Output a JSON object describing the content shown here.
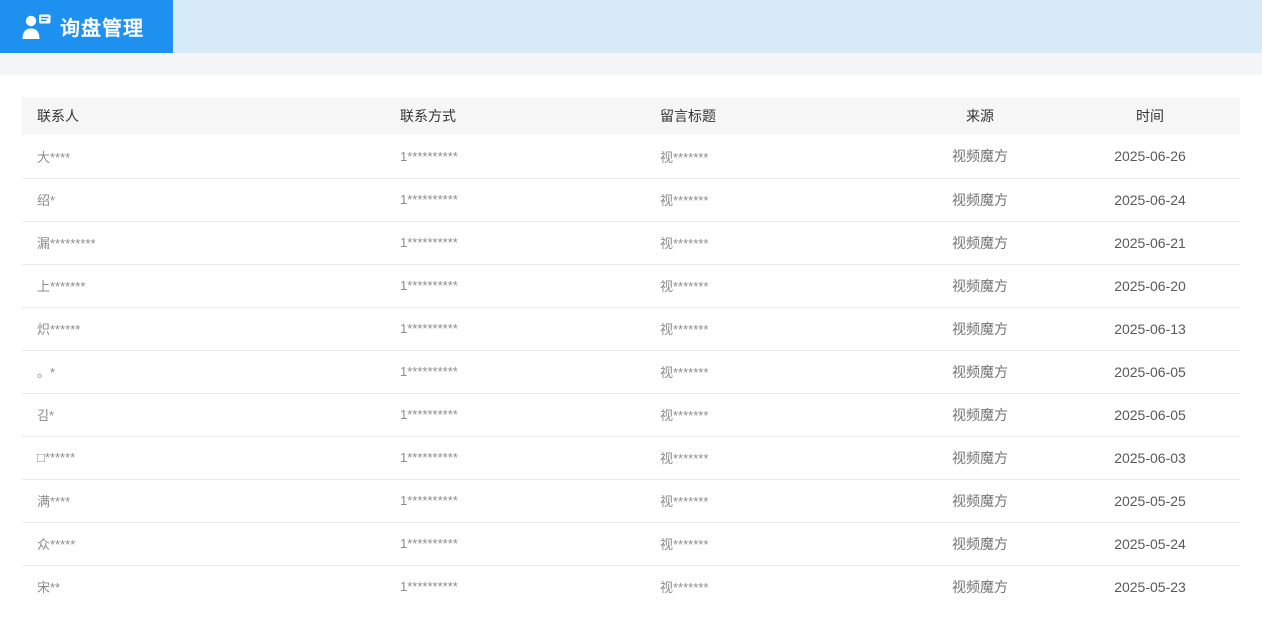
{
  "colors": {
    "tab_blue": "#1e90f0",
    "band_blue": "#d7eaf8",
    "strip_gray": "#f4f5f6",
    "thead_bg": "#f6f6f6",
    "row_border": "#ebebeb"
  },
  "header": {
    "title": "询盘管理",
    "icon": "person-message-icon"
  },
  "table": {
    "columns": [
      {
        "key": "contact",
        "label": "联系人"
      },
      {
        "key": "phone",
        "label": "联系方式"
      },
      {
        "key": "title",
        "label": "留言标题"
      },
      {
        "key": "source",
        "label": "来源"
      },
      {
        "key": "date",
        "label": "时间"
      }
    ],
    "rows": [
      {
        "contact": "大****",
        "phone": "1**********",
        "title": "视*******",
        "source": "视频魔方",
        "date": "2025-06-26"
      },
      {
        "contact": "绍*",
        "phone": "1**********",
        "title": "视*******",
        "source": "视频魔方",
        "date": "2025-06-24"
      },
      {
        "contact": "漏*********",
        "phone": "1**********",
        "title": "视*******",
        "source": "视频魔方",
        "date": "2025-06-21"
      },
      {
        "contact": "上*******",
        "phone": "1**********",
        "title": "视*******",
        "source": "视频魔方",
        "date": "2025-06-20"
      },
      {
        "contact": "炽******",
        "phone": "1**********",
        "title": "视*******",
        "source": "视频魔方",
        "date": "2025-06-13"
      },
      {
        "contact": "。*",
        "phone": "1**********",
        "title": "视*******",
        "source": "视频魔方",
        "date": "2025-06-05"
      },
      {
        "contact": "김*",
        "phone": "1**********",
        "title": "视*******",
        "source": "视频魔方",
        "date": "2025-06-05"
      },
      {
        "contact": "□******",
        "phone": "1**********",
        "title": "视*******",
        "source": "视频魔方",
        "date": "2025-06-03"
      },
      {
        "contact": "满****",
        "phone": "1**********",
        "title": "视*******",
        "source": "视频魔方",
        "date": "2025-05-25"
      },
      {
        "contact": "众*****",
        "phone": "1**********",
        "title": "视*******",
        "source": "视频魔方",
        "date": "2025-05-24"
      },
      {
        "contact": "宋**",
        "phone": "1**********",
        "title": "视*******",
        "source": "视频魔方",
        "date": "2025-05-23"
      }
    ]
  }
}
